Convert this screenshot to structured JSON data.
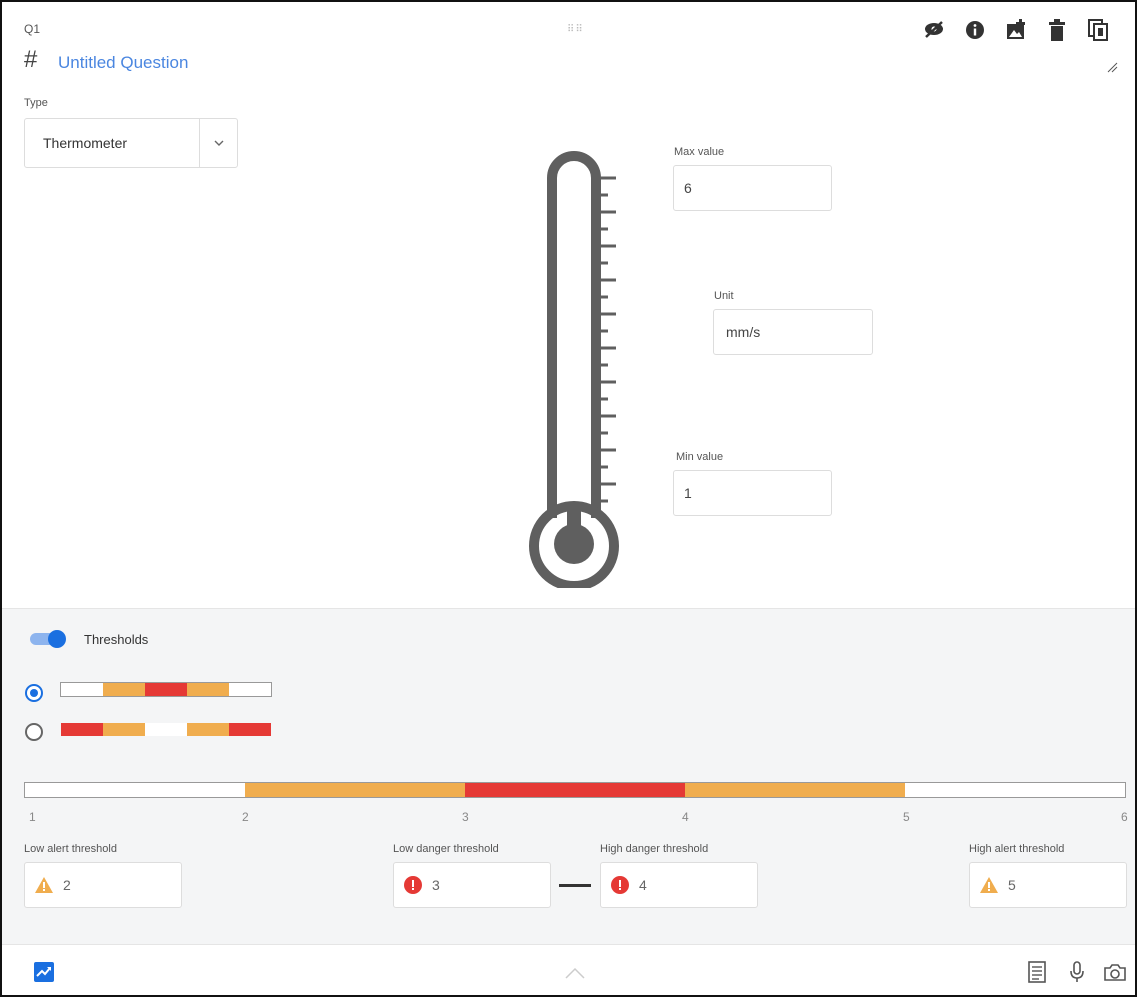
{
  "question": {
    "number": "Q1",
    "hash_symbol": "#",
    "title": "Untitled Question"
  },
  "toolbar": {
    "icons": [
      "eye-slash-icon",
      "info-icon",
      "add-image-icon",
      "trash-icon",
      "duplicate-icon"
    ]
  },
  "type": {
    "label": "Type",
    "value": "Thermometer"
  },
  "fields": {
    "max_label": "Max value",
    "max_value": "6",
    "unit_label": "Unit",
    "unit_value": "mm/s",
    "min_label": "Min value",
    "min_value": "1"
  },
  "thresholds": {
    "label": "Thresholds",
    "enabled": true,
    "scale_ticks": [
      "1",
      "2",
      "3",
      "4",
      "5",
      "6"
    ],
    "low_alert_label": "Low alert threshold",
    "low_alert_value": "2",
    "low_danger_label": "Low danger threshold",
    "low_danger_value": "3",
    "high_danger_label": "High danger threshold",
    "high_danger_value": "4",
    "high_alert_label": "High alert threshold",
    "high_alert_value": "5"
  },
  "colors": {
    "accent": "#1a6fe0",
    "title_blue": "#4a86e0",
    "alert_orange": "#f0ad4e",
    "danger_red": "#e53935",
    "thermometer_gray": "#5f5f5f"
  },
  "footer": {
    "icons": [
      "chart-icon",
      "chevron-up-icon",
      "note-icon",
      "microphone-icon",
      "camera-icon"
    ]
  }
}
